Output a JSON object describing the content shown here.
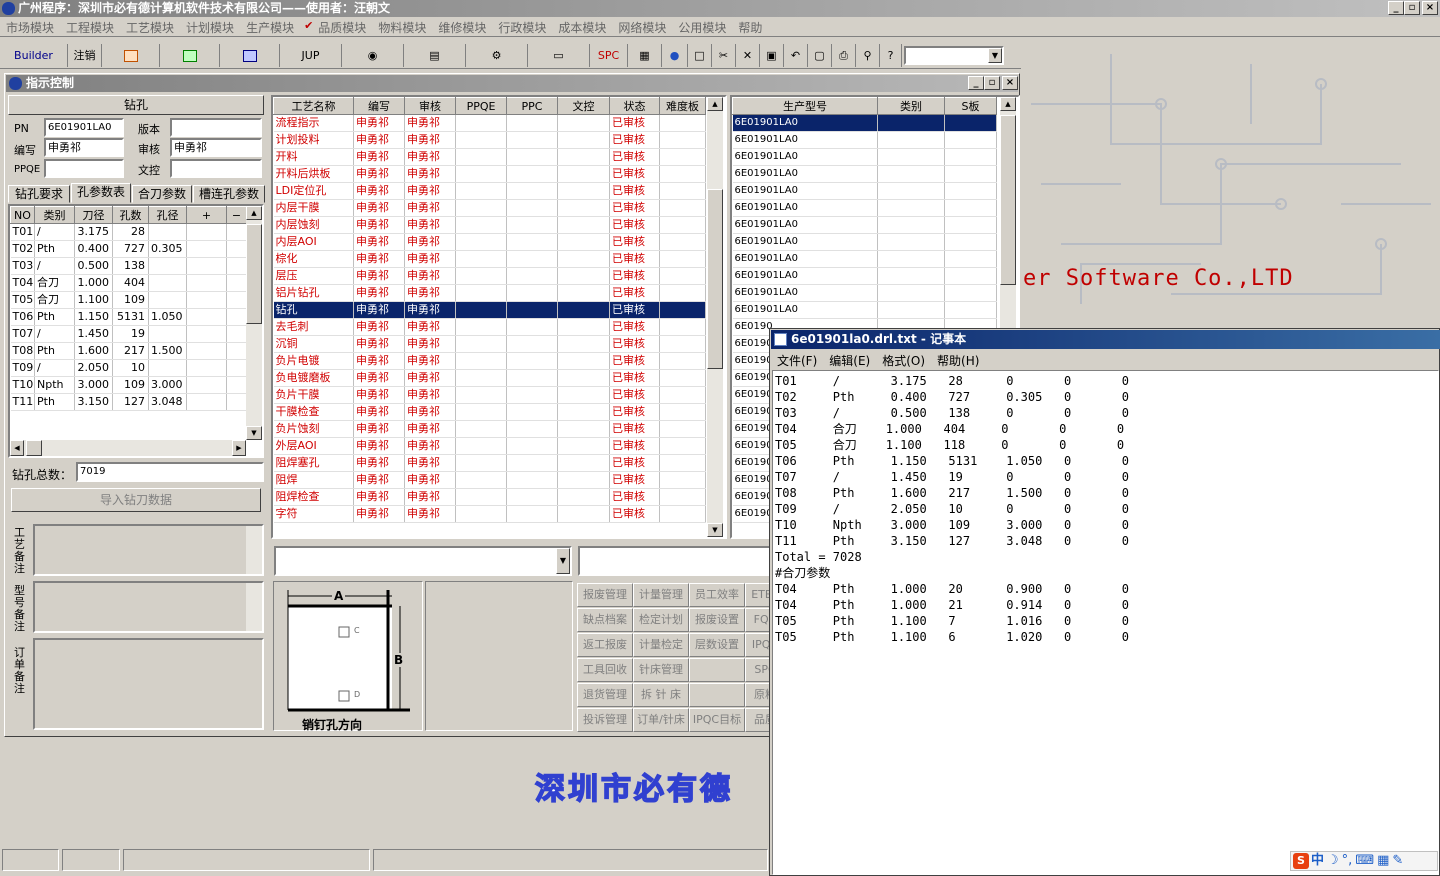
{
  "app": {
    "title": "广州程序：深圳市必有德计算机软件技术有限公司——使用者：汪朝文"
  },
  "menu": [
    "市场模块",
    "工程模块",
    "工艺模块",
    "计划模块",
    "生产模块",
    "品质模块",
    "物料模块",
    "维修模块",
    "行政模块",
    "成本模块",
    "网络模块",
    "公用模块",
    "帮助"
  ],
  "toolbar": {
    "builder": "Builder",
    "logout": "注销",
    "jup": "JUP",
    "spc": "SPC"
  },
  "control": {
    "title": "指示控制",
    "section": "钻孔",
    "pn_label": "PN",
    "pn_value": "6E01901LA0",
    "version_label": "版本",
    "version_value": "",
    "editor_label": "编写",
    "editor_value": "申勇祁",
    "reviewer_label": "审核",
    "reviewer_value": "申勇祁",
    "ppqe_label": "PPQE",
    "ppqe_value": "",
    "doc_label": "文控",
    "doc_value": "",
    "tabs": [
      "钻孔要求",
      "孔参数表",
      "合刀参数",
      "槽连孔参数"
    ],
    "hole_headers": [
      "NO",
      "类别",
      "刀径",
      "孔数",
      "孔径",
      "+",
      "−"
    ],
    "holes": [
      [
        "T01",
        "/",
        "3.175",
        "28",
        ""
      ],
      [
        "T02",
        "Pth",
        "0.400",
        "727",
        "0.305"
      ],
      [
        "T03",
        "/",
        "0.500",
        "138",
        ""
      ],
      [
        "T04",
        "合刀",
        "1.000",
        "404",
        ""
      ],
      [
        "T05",
        "合刀",
        "1.100",
        "109",
        ""
      ],
      [
        "T06",
        "Pth",
        "1.150",
        "5131",
        "1.050"
      ],
      [
        "T07",
        "/",
        "1.450",
        "19",
        ""
      ],
      [
        "T08",
        "Pth",
        "1.600",
        "217",
        "1.500"
      ],
      [
        "T09",
        "/",
        "2.050",
        "10",
        ""
      ],
      [
        "T10",
        "Npth",
        "3.000",
        "109",
        "3.000"
      ],
      [
        "T11",
        "Pth",
        "3.150",
        "127",
        "3.048"
      ]
    ],
    "total_label": "钻孔总数：",
    "total_value": "7019",
    "import_button": "导入钻刀数据",
    "remark_labels": [
      "工艺备注",
      "型号备注",
      "订单备注"
    ]
  },
  "process": {
    "headers": [
      "工艺名称",
      "编写",
      "审核",
      "PPQE",
      "PPC",
      "文控",
      "状态",
      "难度板"
    ],
    "rows": [
      [
        "流程指示",
        "申勇祁",
        "申勇祁",
        "已审核"
      ],
      [
        "计划投料",
        "申勇祁",
        "申勇祁",
        "已审核"
      ],
      [
        "开料",
        "申勇祁",
        "申勇祁",
        "已审核"
      ],
      [
        "开料后烘板",
        "申勇祁",
        "申勇祁",
        "已审核"
      ],
      [
        "LDI定位孔",
        "申勇祁",
        "申勇祁",
        "已审核"
      ],
      [
        "内层干膜",
        "申勇祁",
        "申勇祁",
        "已审核"
      ],
      [
        "内层蚀刻",
        "申勇祁",
        "申勇祁",
        "已审核"
      ],
      [
        "内层AOI",
        "申勇祁",
        "申勇祁",
        "已审核"
      ],
      [
        "棕化",
        "申勇祁",
        "申勇祁",
        "已审核"
      ],
      [
        "层压",
        "申勇祁",
        "申勇祁",
        "已审核"
      ],
      [
        "铝片钻孔",
        "申勇祁",
        "申勇祁",
        "已审核"
      ],
      [
        "钻孔",
        "申勇祁",
        "申勇祁",
        "已审核"
      ],
      [
        "去毛刺",
        "申勇祁",
        "申勇祁",
        "已审核"
      ],
      [
        "沉铜",
        "申勇祁",
        "申勇祁",
        "已审核"
      ],
      [
        "负片电镀",
        "申勇祁",
        "申勇祁",
        "已审核"
      ],
      [
        "负电镀磨板",
        "申勇祁",
        "申勇祁",
        "已审核"
      ],
      [
        "负片干膜",
        "申勇祁",
        "申勇祁",
        "已审核"
      ],
      [
        "干膜检查",
        "申勇祁",
        "申勇祁",
        "已审核"
      ],
      [
        "负片蚀刻",
        "申勇祁",
        "申勇祁",
        "已审核"
      ],
      [
        "外层AOI",
        "申勇祁",
        "申勇祁",
        "已审核"
      ],
      [
        "阻焊塞孔",
        "申勇祁",
        "申勇祁",
        "已审核"
      ],
      [
        "阻焊",
        "申勇祁",
        "申勇祁",
        "已审核"
      ],
      [
        "阻焊检查",
        "申勇祁",
        "申勇祁",
        "已审核"
      ],
      [
        "字符",
        "申勇祁",
        "申勇祁",
        "已审核"
      ]
    ],
    "selected_index": 11
  },
  "models": {
    "headers": [
      "生产型号",
      "类别",
      "S板"
    ],
    "rows": [
      "6E01901LA0",
      "6E01901LA0",
      "6E01901LA0",
      "6E01901LA0",
      "6E01901LA0",
      "6E01901LA0",
      "6E01901LA0",
      "6E01901LA0",
      "6E01901LA0",
      "6E01901LA0",
      "6E01901LA0",
      "6E01901LA0",
      "6E0190",
      "6E0190",
      "6E0190",
      "6E0190",
      "6E0190",
      "6E0190",
      "6E0190",
      "6E0190",
      "6E0190",
      "6E0190",
      "6E0190",
      "6E0190"
    ]
  },
  "diagram": {
    "a": "A",
    "b": "B",
    "c": "C",
    "d": "D",
    "caption": "销钉孔方向"
  },
  "buttons": [
    [
      "报废管理",
      "计量管理",
      "员工效率",
      "ETES"
    ],
    [
      "缺点档案",
      "检定计划",
      "报废设置",
      "FQC"
    ],
    [
      "返工报废",
      "计量检定",
      "层数设置",
      "IPQC"
    ],
    [
      "工具回收",
      "针床管理",
      "",
      "SPC"
    ],
    [
      "退货管理",
      "拆 针 床",
      "",
      "原料"
    ],
    [
      "投诉管理",
      "订单/针床",
      "IPQC目标",
      "品质"
    ]
  ],
  "background": {
    "company_en": "er Software Co.,LTD",
    "company_cn": "深圳市必有德"
  },
  "notepad": {
    "title": "6e01901la0.drl.txt - 记事本",
    "menu": [
      "文件(F)",
      "编辑(E)",
      "格式(O)",
      "帮助(H)"
    ],
    "lines": [
      "T01     /       3.175   28      0       0       0",
      "T02     Pth     0.400   727     0.305   0       0",
      "T03     /       0.500   138     0       0       0",
      "T04     合刀    1.000   404     0       0       0",
      "T05     合刀    1.100   118     0       0       0",
      "T06     Pth     1.150   5131    1.050   0       0",
      "T07     /       1.450   19      0       0       0",
      "T08     Pth     1.600   217     1.500   0       0",
      "T09     /       2.050   10      0       0       0",
      "T10     Npth    3.000   109     3.000   0       0",
      "T11     Pth     3.150   127     3.048   0       0",
      "Total = 7028",
      "#合刀参数",
      "T04     Pth     1.000   20      0.900   0       0",
      "T04     Pth     1.000   21      0.914   0       0",
      "T05     Pth     1.100   7       1.016   0       0",
      "T05     Pth     1.100   6       1.020   0       0"
    ]
  },
  "ime": {
    "label": "中"
  },
  "colors": {
    "selection": "#0a246a",
    "process_text": "#d00000",
    "company_text": "#c00000",
    "watermark": "#3040d0"
  }
}
